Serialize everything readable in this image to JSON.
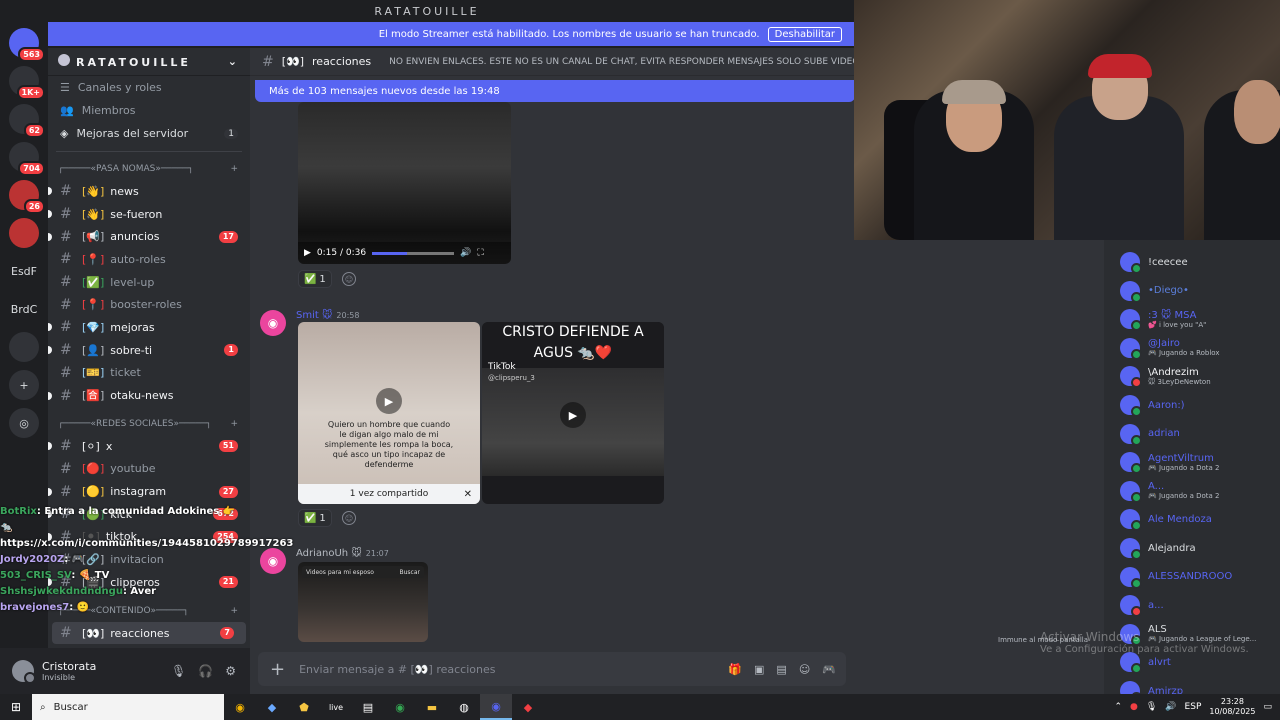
{
  "window": {
    "title": "RATATOUILLE"
  },
  "rail": {
    "servers": [
      {
        "label": "",
        "badge": "563"
      },
      {
        "label": "",
        "badge": "1K+"
      },
      {
        "label": "",
        "badge": "62"
      },
      {
        "label": "",
        "badge": "704"
      },
      {
        "label": "",
        "badge": "26"
      },
      {
        "label": "",
        "badge": ""
      },
      {
        "label": "EsdF",
        "badge": ""
      },
      {
        "label": "BrdC",
        "badge": ""
      },
      {
        "label": "",
        "badge": ""
      }
    ]
  },
  "banner": {
    "text": "El modo Streamer está habilitado. Los nombres de usuario se han truncado.",
    "button": "Deshabilitar"
  },
  "sidebar": {
    "guild_name": "RATATOUILLE",
    "links": [
      {
        "label": "Canales y roles",
        "count": ""
      },
      {
        "label": "Miembros",
        "count": ""
      },
      {
        "label": "Mejoras del servidor",
        "count": "1"
      }
    ],
    "categories": [
      {
        "name": "┌─────«PASA NOMAS»─────┐",
        "channels": [
          {
            "name": "news",
            "prefix": "[👋]",
            "color": "#f5c542",
            "unread": true,
            "badge": ""
          },
          {
            "name": "se-fueron",
            "prefix": "[👋]",
            "color": "#f5c542",
            "unread": true,
            "badge": ""
          },
          {
            "name": "anuncios",
            "prefix": "[📢]",
            "color": "#b5bac1",
            "unread": true,
            "badge": "17"
          },
          {
            "name": "auto-roles",
            "prefix": "[📍]",
            "color": "#f23f43",
            "unread": false,
            "badge": ""
          },
          {
            "name": "level-up",
            "prefix": "[✅]",
            "color": "#3ba55d",
            "unread": false,
            "badge": ""
          },
          {
            "name": "booster-roles",
            "prefix": "[📍]",
            "color": "#f23f43",
            "unread": false,
            "badge": ""
          },
          {
            "name": "mejoras",
            "prefix": "[💎]",
            "color": "#9ad2f5",
            "unread": true,
            "badge": ""
          },
          {
            "name": "sobre-ti",
            "prefix": "[👤]",
            "color": "#b5bac1",
            "unread": true,
            "badge": "1"
          },
          {
            "name": "ticket",
            "prefix": "[🎫]",
            "color": "#9ad2f5",
            "unread": false,
            "badge": ""
          },
          {
            "name": "otaku-news",
            "prefix": "[🈴]",
            "color": "#b5bac1",
            "unread": true,
            "badge": ""
          }
        ]
      },
      {
        "name": "┌─────«REDES SOCIALES»─────┐",
        "channels": [
          {
            "name": "x",
            "prefix": "[⚪]",
            "color": "#f2f3f5",
            "unread": true,
            "badge": "51"
          },
          {
            "name": "youtube",
            "prefix": "[🔴]",
            "color": "#f23f43",
            "unread": false,
            "badge": ""
          },
          {
            "name": "instagram",
            "prefix": "[🟡]",
            "color": "#f5c542",
            "unread": true,
            "badge": "27"
          },
          {
            "name": "kick",
            "prefix": "[🟢]",
            "color": "#3ba55d",
            "unread": true,
            "badge": "672"
          },
          {
            "name": "tiktok",
            "prefix": "[⚫]",
            "color": "#555",
            "unread": true,
            "badge": "254"
          },
          {
            "name": "invitacion",
            "prefix": "[🔗]",
            "color": "#b5bac1",
            "unread": false,
            "badge": ""
          },
          {
            "name": "clipperos",
            "prefix": "[🎬]",
            "color": "#b5bac1",
            "unread": true,
            "badge": "21"
          }
        ]
      },
      {
        "name": "┌─────«CONTENIDO»─────┐",
        "channels": [
          {
            "name": "reacciones",
            "prefix": "[👀]",
            "color": "#f2f3f5",
            "unread": true,
            "badge": "7"
          }
        ]
      }
    ]
  },
  "overlay_chat": [
    {
      "user": "BotRix",
      "text": ": Entra a la comunidad Adokines 👉 🐀",
      "userColor": "g"
    },
    {
      "user": "",
      "text": "https://x.com/i/communities/1944581029789917263",
      "userColor": "w"
    },
    {
      "user": "Jordy2020Z",
      "text": ": 🎮",
      "userColor": "p"
    },
    {
      "user": "503_CRIS_SV",
      "text": ": 🍕 TV",
      "userColor": "g"
    },
    {
      "user": "Shshsjwkekdndndngu",
      "text": ": Aver",
      "userColor": "g"
    },
    {
      "user": "bravejones7",
      "text": ": 🙂",
      "userColor": "p"
    }
  ],
  "user_panel": {
    "name": "Cristorata",
    "status": "Invisible"
  },
  "chat": {
    "channel_prefix": "[👀]",
    "channel_name": "reacciones",
    "topic": "NO ENVIEN ENLACES. ESTE NO ES UN CANAL DE CHAT, EVITA RESPONDER MENSAJES SOLO SUBE VIDEOS",
    "new_messages": "Más de 103 mensajes nuevos desde las 19:48",
    "video_time": "0:15 / 0:36",
    "video_progress": 0.42,
    "reaction_count": "1",
    "messages": [
      {
        "author": "Smit 🐭",
        "time": "20:58"
      },
      {
        "author": "AdrianoUh 🐭",
        "time": "21:07"
      }
    ],
    "tile1_caption": "Quiero un hombre que cuando le digan algo malo de mi simplemente les rompa la boca, qué asco un tipo incapaz de defenderme",
    "tile1_shared": "1 vez compartido",
    "tile2_title": "CRISTO DEFIENDE A AGUS 🐀❤️",
    "tile2_tiktok": "TikTok",
    "tile2_handle": "@clipsperu_3",
    "tile3_search": "Videos para mi esposo",
    "tile3_search_btn": "Buscar",
    "composer_placeholder": "Enviar mensaje a # [👀] reacciones"
  },
  "members": [
    {
      "name": "!ceecee",
      "sub": "",
      "color": "",
      "dnd": false
    },
    {
      "name": "•Diego•",
      "sub": "",
      "color": "lblue",
      "dnd": false
    },
    {
      "name": ":3 🐭 MSA",
      "sub": "💕 i love you \"A\"",
      "color": "blue",
      "dnd": false
    },
    {
      "name": "@Jairo",
      "sub": "🎮 Jugando a Roblox",
      "color": "blue",
      "dnd": false
    },
    {
      "name": "\\Andrezim",
      "sub": "🐭 3LeyDeNewton",
      "color": "white",
      "dnd": true
    },
    {
      "name": "Aaron:)",
      "sub": "",
      "color": "blue",
      "dnd": false
    },
    {
      "name": "adrian",
      "sub": "",
      "color": "blue",
      "dnd": false
    },
    {
      "name": "AgentViltrum",
      "sub": "🎮 Jugando a Dota 2",
      "color": "blue",
      "dnd": false
    },
    {
      "name": "A...",
      "sub": "🎮 Jugando a Dota 2",
      "color": "blue",
      "dnd": false
    },
    {
      "name": "Ale Mendoza",
      "sub": "",
      "color": "blue",
      "dnd": false
    },
    {
      "name": "Alejandra",
      "sub": "",
      "color": "",
      "dnd": false
    },
    {
      "name": "ALESSANDROOO",
      "sub": "",
      "color": "blue",
      "dnd": false
    },
    {
      "name": "a...",
      "sub": "",
      "color": "blue",
      "dnd": true
    },
    {
      "name": "ALS",
      "sub": "🎮 Jugando a League of Lege...",
      "color": "",
      "dnd": false
    },
    {
      "name": "alvrt",
      "sub": "",
      "color": "blue",
      "dnd": false
    },
    {
      "name": "Amirzp",
      "sub": "",
      "color": "blue",
      "dnd": false
    }
  ],
  "windows": {
    "activate_title": "Activar Windows",
    "activate_sub": "Ve a Configuración para activar Windows.",
    "immune": "Immune al modo pantalla"
  },
  "taskbar": {
    "search": "Buscar",
    "lang": "ESP",
    "time": "23:28",
    "date": "10/08/2025"
  }
}
